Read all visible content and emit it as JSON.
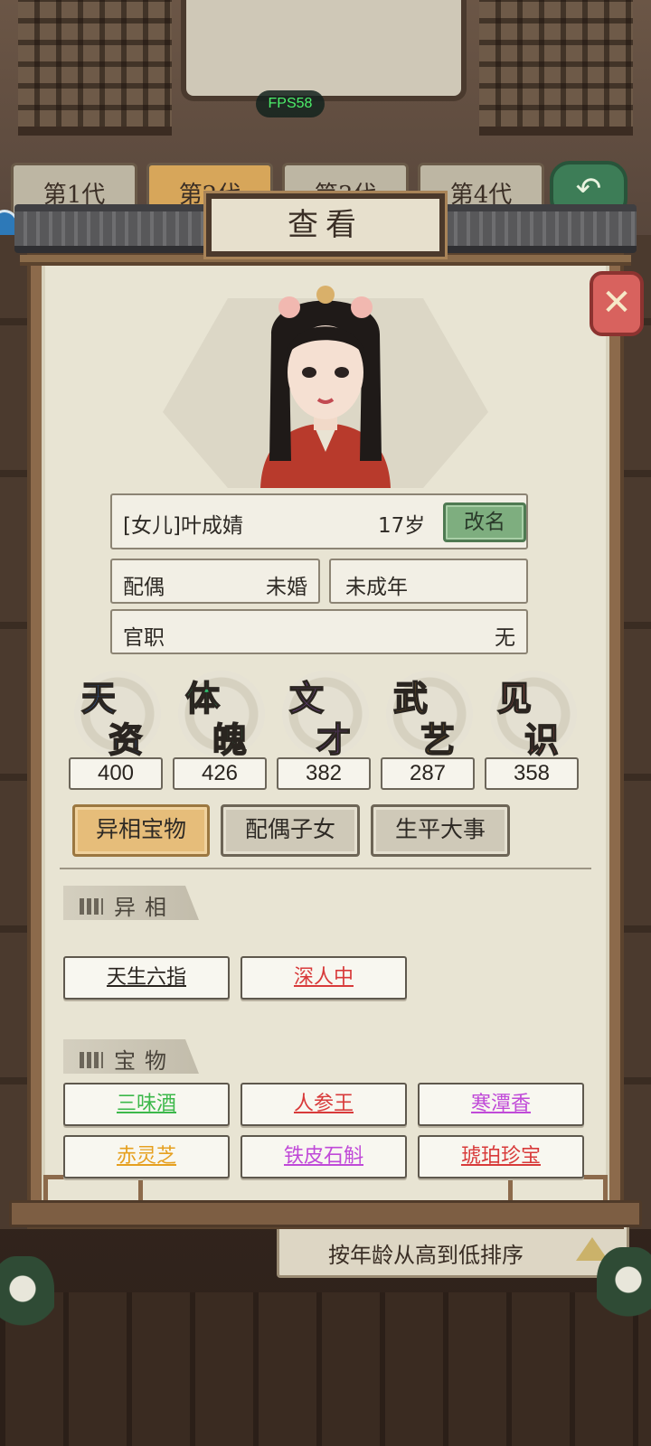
{
  "hud": {
    "fps": "FPS58"
  },
  "generation_tabs": [
    {
      "label": "第1代",
      "active": false
    },
    {
      "label": "第2代",
      "active": true
    },
    {
      "label": "第3代",
      "active": false
    },
    {
      "label": "第4代",
      "active": false
    }
  ],
  "sort_bar": {
    "label": "按年龄从高到低排序"
  },
  "dialog": {
    "title": "查看",
    "close_icon": "✕"
  },
  "character": {
    "name": "[女儿]叶成婧",
    "age": "17岁",
    "rename_label": "改名",
    "spouse_label": "配偶",
    "spouse_value": "未婚",
    "adult_status": "未成年",
    "office_label": "官职",
    "office_value": "无"
  },
  "stats": [
    {
      "char1": "天",
      "char2": "资",
      "color": "#2f6fd6",
      "value": "400"
    },
    {
      "char1": "体",
      "char2": "魄",
      "color": "#2fb46a",
      "value": "426"
    },
    {
      "char1": "文",
      "char2": "才",
      "color": "#9a53d1",
      "value": "382"
    },
    {
      "char1": "武",
      "char2": "艺",
      "color": "#e0a235",
      "value": "287"
    },
    {
      "char1": "见",
      "char2": "识",
      "color": "#d9605c",
      "value": "358"
    }
  ],
  "tabs": [
    {
      "label": "异相宝物",
      "active": true
    },
    {
      "label": "配偶子女",
      "active": false
    },
    {
      "label": "生平大事",
      "active": false
    }
  ],
  "traits_section": {
    "title": "异相",
    "items": [
      {
        "label": "天生六指",
        "color": "#2a2520"
      },
      {
        "label": "深人中",
        "color": "#d83a3a"
      }
    ]
  },
  "treasures_section": {
    "title": "宝物",
    "items": [
      {
        "label": "三味酒",
        "color": "#3cb84a"
      },
      {
        "label": "人参王",
        "color": "#d83a3a"
      },
      {
        "label": "寒潭香",
        "color": "#c04ad8"
      },
      {
        "label": "赤灵芝",
        "color": "#e6a020"
      },
      {
        "label": "铁皮石斛",
        "color": "#c04ad8"
      },
      {
        "label": "琥珀珍宝",
        "color": "#d83a3a"
      }
    ]
  }
}
